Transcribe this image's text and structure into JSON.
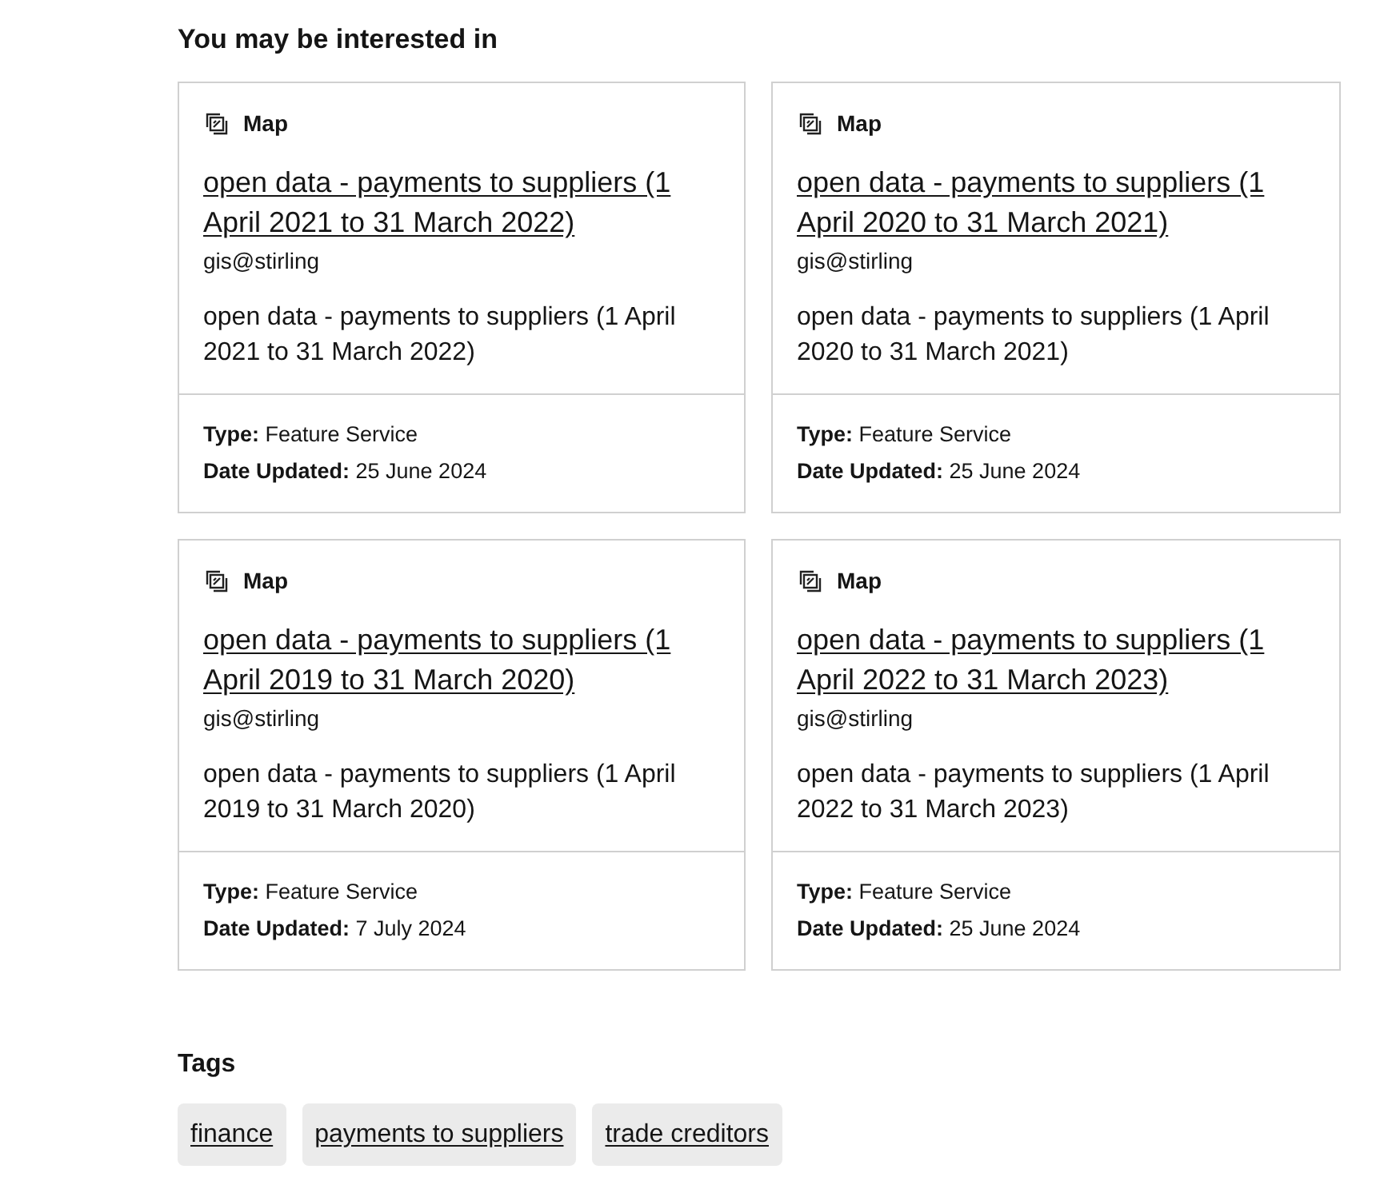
{
  "section": {
    "title": "You may be interested in"
  },
  "cards": [
    {
      "kind_label": "Map",
      "title": "open data - payments to suppliers (1 April 2021 to 31 March 2022)",
      "owner": "gis@stirling",
      "description": "open data - payments to suppliers (1 April 2021 to 31 March 2022)",
      "type_line": "**Type:** Feature Service",
      "date_line": "**Date Updated:** 25 June 2024"
    },
    {
      "kind_label": "Map",
      "title": "open data - payments to suppliers (1 April 2020 to 31 March 2021)",
      "owner": "gis@stirling",
      "description": "open data - payments to suppliers (1 April 2020 to 31 March 2021)",
      "type_line": "**Type:** Feature Service",
      "date_line": "**Date Updated:** 25 June 2024"
    },
    {
      "kind_label": "Map",
      "title": "open data - payments to suppliers (1 April 2019 to 31 March 2020)",
      "owner": "gis@stirling",
      "description": "open data - payments to suppliers (1 April 2019 to 31 March 2020)",
      "type_line": "**Type:** Feature Service",
      "date_line": "**Date Updated:** 7 July 2024"
    },
    {
      "kind_label": "Map",
      "title": "open data - payments to suppliers (1 April 2022 to 31 March 2023)",
      "owner": "gis@stirling",
      "description": "open data - payments to suppliers (1 April 2022 to 31 March 2023)",
      "type_line": "**Type:** Feature Service",
      "date_line": "**Date Updated:** 25 June 2024"
    }
  ],
  "tags": {
    "title": "Tags",
    "items": [
      "finance",
      "payments to suppliers",
      "trade creditors"
    ]
  }
}
